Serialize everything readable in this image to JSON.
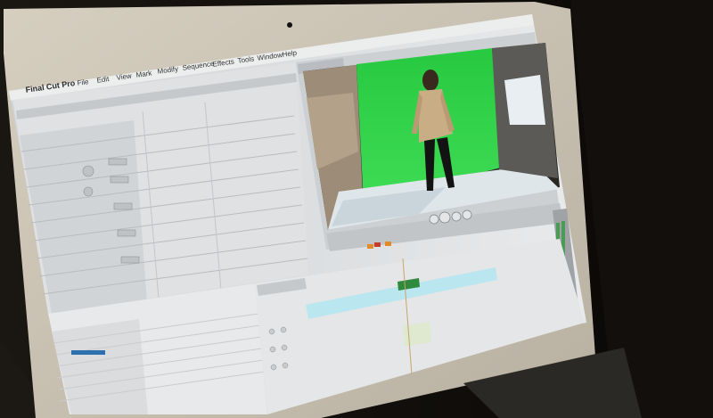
{
  "app": {
    "title": "Final Cut Pro",
    "menus": [
      "File",
      "Edit",
      "View",
      "Mark",
      "Modify",
      "Sequence",
      "Effects",
      "Tools",
      "Window",
      "Help"
    ]
  },
  "scene": {
    "subject": "person-in-front-of-green-screen",
    "colors": {
      "laptop_bezel": "#c9c2b3",
      "screen_bg": "#d9dbdd",
      "green_screen": "#2fd24a",
      "timeline_clip": "#b9e6ef",
      "dark_background": "#0d0b09"
    }
  },
  "icons": [
    "apple-logo-icon",
    "play-icon",
    "stop-icon",
    "playhead-icon",
    "webcam-icon"
  ]
}
